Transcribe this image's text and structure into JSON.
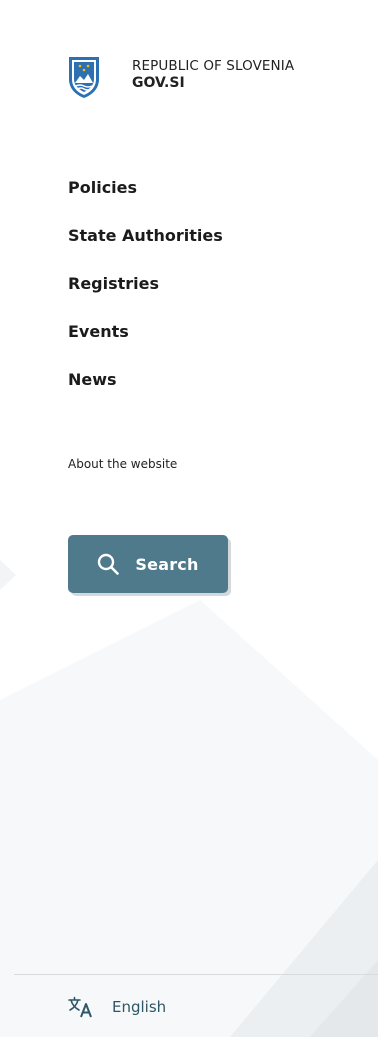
{
  "header": {
    "logo": {
      "line1": "REPUBLIC OF SLOVENIA",
      "line2": "GOV.SI",
      "emblem_icon": "slovenia-coat-of-arms"
    }
  },
  "nav": {
    "items": [
      {
        "label": "Policies"
      },
      {
        "label": "State Authorities"
      },
      {
        "label": "Registries"
      },
      {
        "label": "Events"
      },
      {
        "label": "News"
      }
    ]
  },
  "secondary": {
    "about_label": "About the website"
  },
  "search": {
    "label": "Search",
    "icon": "search-icon"
  },
  "footer": {
    "language_label": "English",
    "icon": "translate-icon"
  },
  "colors": {
    "accent": "#4f7a8c",
    "link": "#2f5667",
    "emblem_blue": "#2c6fb3",
    "divider": "#d7dbde"
  }
}
